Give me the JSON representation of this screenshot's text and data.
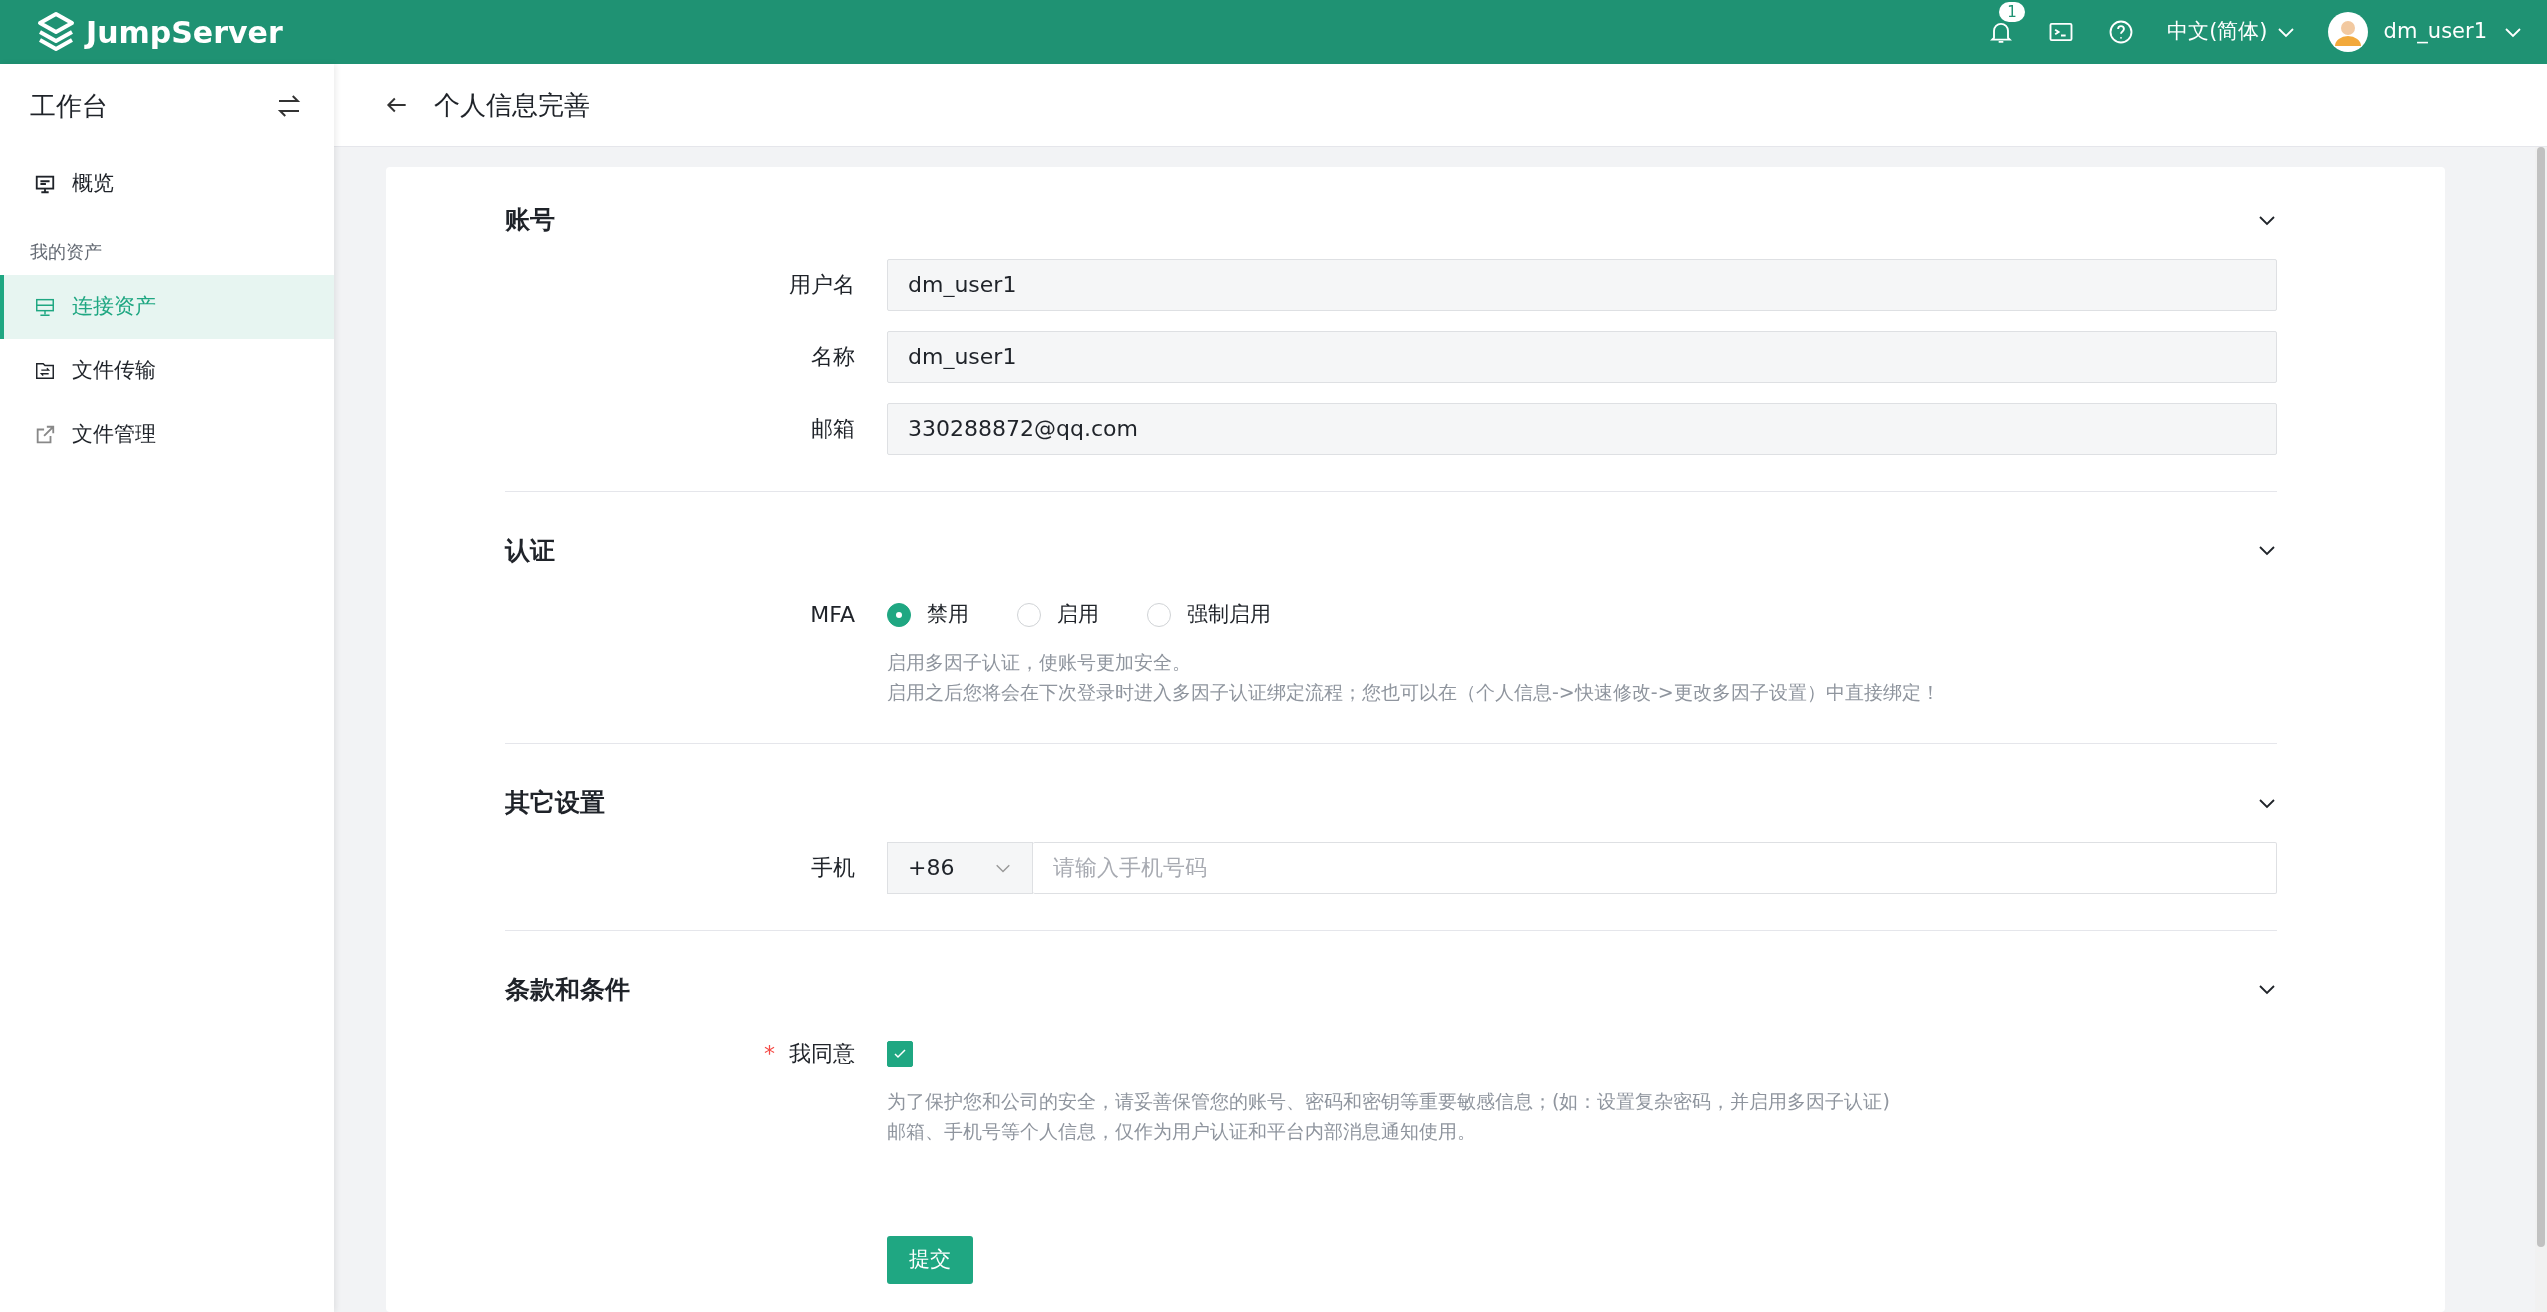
{
  "topbar": {
    "logo": "JumpServer",
    "notification_count": "1",
    "language": "中文(简体)",
    "user": "dm_user1"
  },
  "sidebar": {
    "title": "工作台",
    "items": [
      {
        "kind": "item",
        "label": "概览",
        "selected": false
      },
      {
        "kind": "group",
        "label": "我的资产"
      },
      {
        "kind": "item",
        "label": "连接资产",
        "selected": true
      },
      {
        "kind": "item",
        "label": "文件传输",
        "selected": false
      },
      {
        "kind": "item",
        "label": "文件管理",
        "selected": false
      }
    ]
  },
  "header": {
    "title": "个人信息完善"
  },
  "sections": [
    {
      "title": "账号",
      "expanded": true,
      "fields": [
        {
          "kind": "text",
          "label": "用户名",
          "value": "dm_user1",
          "disabled": true
        },
        {
          "kind": "text",
          "label": "名称",
          "value": "dm_user1",
          "disabled": true
        },
        {
          "kind": "text",
          "label": "邮箱",
          "value": "330288872@qq.com",
          "disabled": true
        }
      ]
    },
    {
      "title": "认证",
      "expanded": true,
      "fields": [
        {
          "kind": "radio",
          "label": "MFA",
          "options": [
            {
              "label": "禁用",
              "selected": true
            },
            {
              "label": "启用",
              "selected": false
            },
            {
              "label": "强制启用",
              "selected": false
            }
          ],
          "help": [
            "启用多因子认证，使账号更加安全。",
            "启用之后您将会在下次登录时进入多因子认证绑定流程；您也可以在（个人信息->快速修改->更改多因子设置）中直接绑定！"
          ]
        }
      ]
    },
    {
      "title": "其它设置",
      "expanded": true,
      "fields": [
        {
          "kind": "phone",
          "label": "手机",
          "code": "+86",
          "placeholder": "请输入手机号码"
        }
      ]
    },
    {
      "title": "条款和条件",
      "expanded": true,
      "fields": [
        {
          "kind": "checkbox",
          "label": "我同意",
          "required_mark": "*",
          "checked": true,
          "help": [
            "为了保护您和公司的安全，请妥善保管您的账号、密码和密钥等重要敏感信息；(如：设置复杂密码，并启用多因子认证)",
            "邮箱、手机号等个人信息，仅作为用户认证和平台内部消息通知使用。"
          ]
        }
      ]
    }
  ],
  "submit": "提交"
}
